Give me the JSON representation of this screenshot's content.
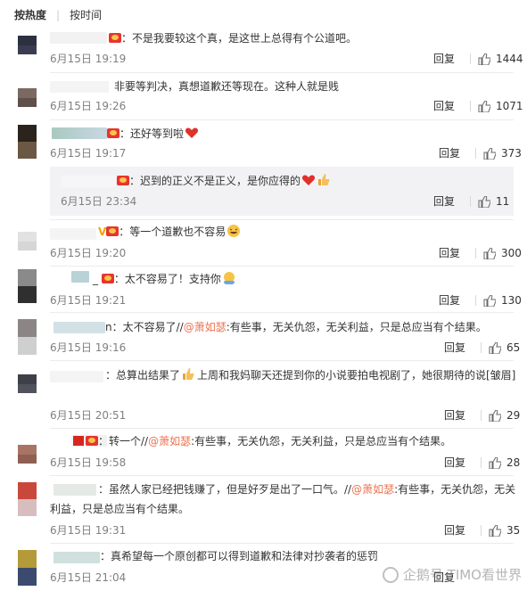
{
  "tabs": {
    "hot": "按热度",
    "time": "按时间"
  },
  "reply_label": "回复",
  "comments": [
    {
      "text": "：不是我要较这个真，是这世上总得有个公道吧。",
      "time": "6月15日 19:19",
      "likes": "1444"
    },
    {
      "text": "非要等判决，真想道歉还等现在。这种人就是贱",
      "time": "6月15日 19:26",
      "likes": "1071"
    },
    {
      "text": "：还好等到啦",
      "time": "6月15日 19:17",
      "likes": "373"
    },
    {
      "text": "：迟到的正义不是正义，是你应得的",
      "time": "6月15日 23:34",
      "likes": "11"
    },
    {
      "prefix": "V",
      "text": "：等一个道歉也不容易",
      "time": "6月15日 19:20",
      "likes": "300"
    },
    {
      "prefix": "_",
      "text": "：太不容易了！支持你",
      "time": "6月15日 19:21",
      "likes": "130"
    },
    {
      "prefix": "n",
      "text_a": "：太不容易了//",
      "mention": "@萧如瑟",
      "text_b": ":有些事，无关仇怨，无关利益，只是总应当有个结果。",
      "time": "6月15日 19:16",
      "likes": "65"
    },
    {
      "text": "：总算出结果了",
      "text_2": "上周和我妈聊天还提到你的小说要拍电视剧了，她很期待的说[皱眉]",
      "time": "6月15日 20:51",
      "likes": "29"
    },
    {
      "text_a": "：转一个//",
      "mention": "@萧如瑟",
      "text_b": ":有些事，无关仇怨，无关利益，只是总应当有个结果。",
      "time": "6月15日 19:58",
      "likes": "28"
    },
    {
      "text_a": "：虽然人家已经把钱赚了，但是好歹是出了一口气。//",
      "mention": "@萧如瑟",
      "text_b": ":有些事，无关仇怨，无关利益，只是总应当有个结果。",
      "time": "6月15日 19:31",
      "likes": "35"
    },
    {
      "text": "：真希望每一个原创都可以得到道歉和法律对抄袭者的惩罚",
      "time": "6月15日 21:04",
      "likes": ""
    }
  ],
  "watermark": "企鹅号 TIMO看世界",
  "colors": {
    "mention": "#eb7350",
    "heart": "#e0312b",
    "meta": "#808080"
  }
}
